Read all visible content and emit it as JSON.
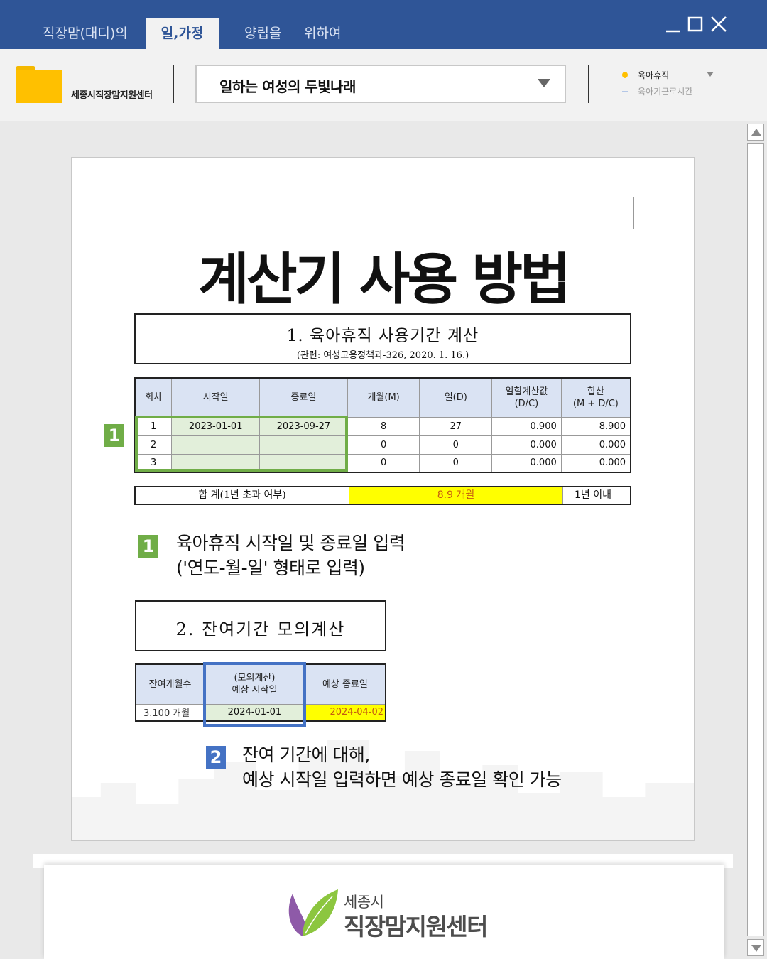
{
  "window": {
    "tabs": [
      {
        "label": "직장맘(대디)의",
        "active": false
      },
      {
        "label": "일,가정",
        "active": true
      },
      {
        "label": "양립을",
        "active": false
      },
      {
        "label": "위하여",
        "active": false
      }
    ],
    "colors": {
      "titlebar": "#2f5597",
      "ribbon": "#f2f2f2",
      "accent_green": "#70ad47",
      "accent_blue": "#4472c4",
      "highlight_yellow": "#ffff00"
    }
  },
  "ribbon": {
    "org_name": "세종시직장맘지원센터",
    "folder_icon": "folder-icon",
    "combo_value": "일하는 여성의 두빛나래",
    "options": [
      {
        "label": "육아휴직",
        "icon": "bulb-icon"
      },
      {
        "label": "육아기근로시간",
        "icon": "dash-icon"
      }
    ]
  },
  "document": {
    "title": "계산기 사용 방법",
    "section1": {
      "heading": "1. 육아휴직 사용기간 계산",
      "subheading": "(관련: 여성고용정책과-326, 2020. 1. 16.)",
      "headers": [
        "회차",
        "시작일",
        "종료일",
        "개월(M)",
        "일(D)",
        "일할계산값\n(D/C)",
        "합산\n(M + D/C)"
      ],
      "rows": [
        [
          "1",
          "2023-01-01",
          "2023-09-27",
          "8",
          "27",
          "0.900",
          "8.900"
        ],
        [
          "2",
          "",
          "",
          "0",
          "0",
          "0.000",
          "0.000"
        ],
        [
          "3",
          "",
          "",
          "0",
          "0",
          "0.000",
          "0.000"
        ]
      ],
      "total_label": "합   계(1년 초과 여부)",
      "total_value": "8.9 개월",
      "total_status": "1년 이내"
    },
    "step1": {
      "badge": "1",
      "line1": "육아휴직 시작일 및 종료일 입력",
      "line2": "('연도-월-일' 형태로 입력)"
    },
    "section2": {
      "heading": "2. 잔여기간 모의계산",
      "headers": [
        "잔여개월수",
        "(모의계산)\n예상 시작일",
        "예상 종료일"
      ],
      "row": [
        "3.100 개월",
        "2024-01-01",
        "2024-04-02"
      ]
    },
    "step2": {
      "badge": "2",
      "line1": "잔여 기간에 대해,",
      "line2": "예상 시작일 입력하면 예상 종료일 확인 가능"
    }
  },
  "footer": {
    "logo_small": "세종시",
    "logo_big": "직장맘지원센터"
  }
}
